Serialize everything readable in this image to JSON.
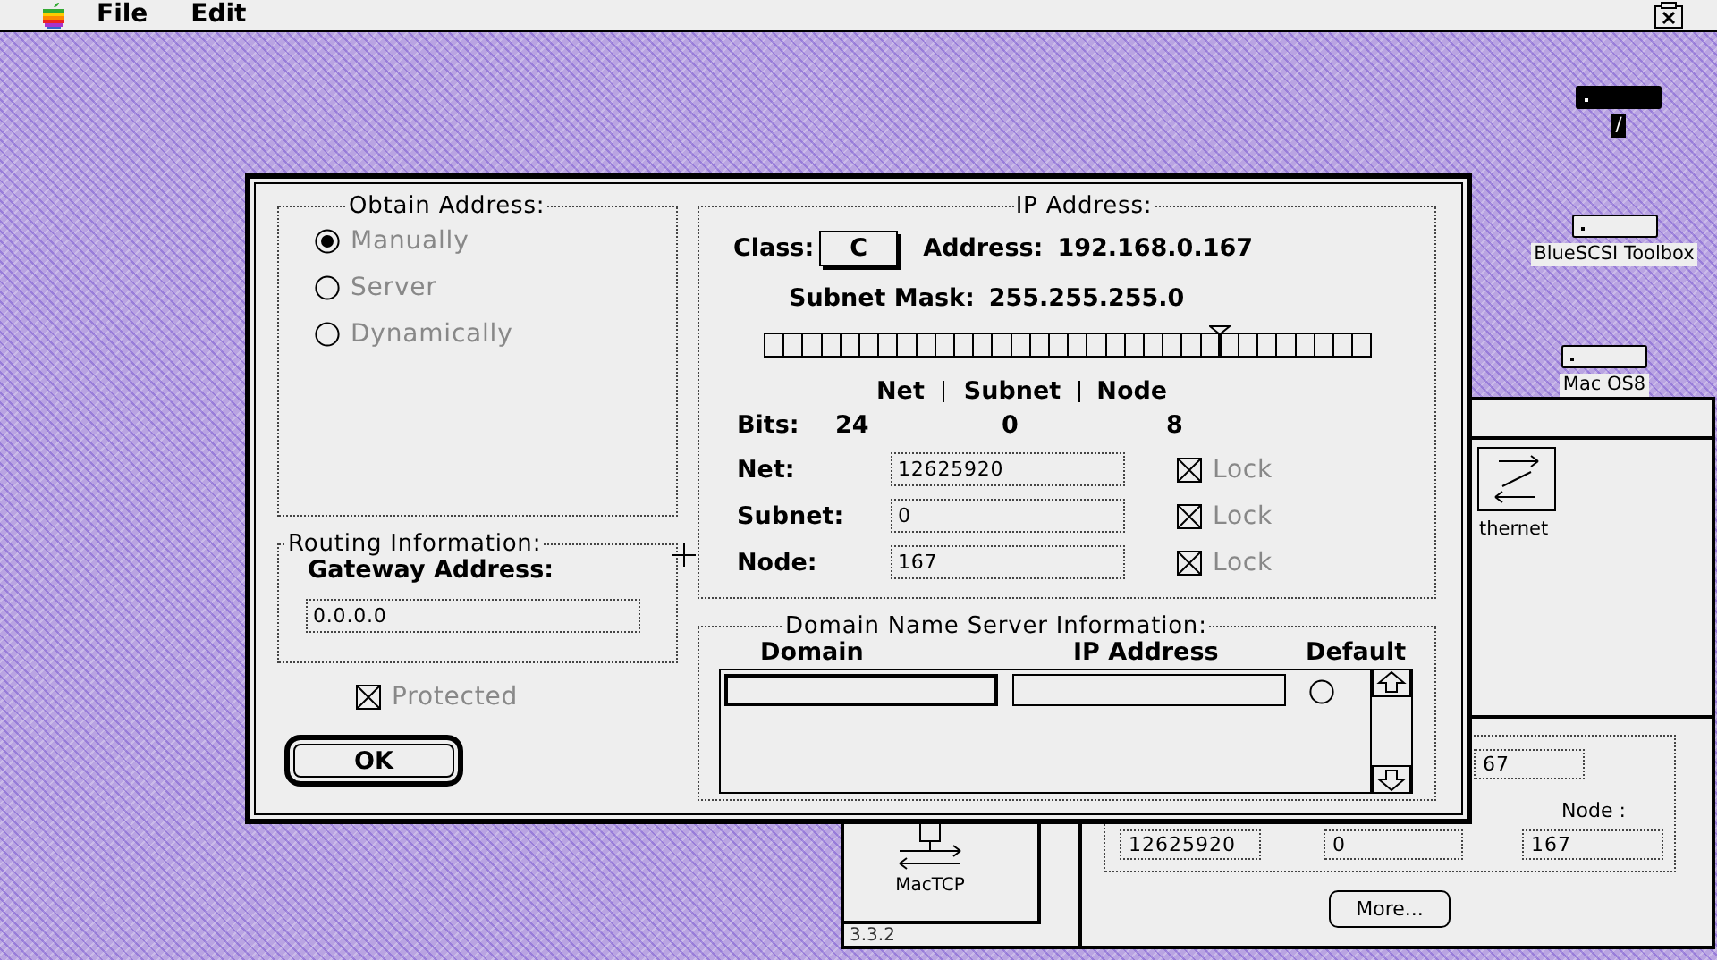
{
  "menubar": {
    "items": [
      {
        "label": "File"
      },
      {
        "label": "Edit"
      }
    ]
  },
  "desktop_icons": [
    {
      "label": "/",
      "selected": true
    },
    {
      "label": "BlueSCSI Toolbox",
      "selected": false
    },
    {
      "label": "Mac OS8",
      "selected": false
    }
  ],
  "config_window": {
    "connection_label": "thernet",
    "partial_field": "67",
    "node_label": "Node :",
    "fields": [
      "12625920",
      "0",
      "167"
    ],
    "more_button": "More..."
  },
  "control_panel_window": {
    "icon_label": "MacTCP",
    "version": "3.3.2"
  },
  "dialog": {
    "obtain_address": {
      "title": "Obtain Address:",
      "disabled": true,
      "options": [
        {
          "label": "Manually",
          "selected": true
        },
        {
          "label": "Server",
          "selected": false
        },
        {
          "label": "Dynamically",
          "selected": false
        }
      ]
    },
    "routing": {
      "title": "Routing Information:",
      "gateway_label": "Gateway Address:",
      "gateway_value": "0.0.0.0"
    },
    "protected": {
      "label": "Protected",
      "checked": true,
      "disabled": true
    },
    "ok_button": "OK",
    "ip_address": {
      "title": "IP Address:",
      "class_label": "Class:",
      "class_value": "C",
      "address_label": "Address:",
      "address_value": "192.168.0.167",
      "subnet_mask_label": "Subnet Mask:",
      "subnet_mask_value": "255.255.255.0",
      "mask_slider": {
        "level": 0.75
      },
      "bit_headers": [
        "Net",
        "Subnet",
        "Node"
      ],
      "bits_label": "Bits:",
      "bits": [
        "24",
        "0",
        "8"
      ],
      "fields": [
        {
          "label": "Net:",
          "value": "12625920",
          "lock": {
            "label": "Lock",
            "checked": true,
            "disabled": true
          }
        },
        {
          "label": "Subnet:",
          "value": "0",
          "lock": {
            "label": "Lock",
            "checked": true,
            "disabled": true
          }
        },
        {
          "label": "Node:",
          "value": "167",
          "lock": {
            "label": "Lock",
            "checked": true,
            "disabled": true
          }
        }
      ]
    },
    "dns": {
      "title": "Domain Name Server Information:",
      "columns": [
        "Domain",
        "IP Address",
        "Default"
      ],
      "entry": {
        "default": false
      }
    }
  }
}
